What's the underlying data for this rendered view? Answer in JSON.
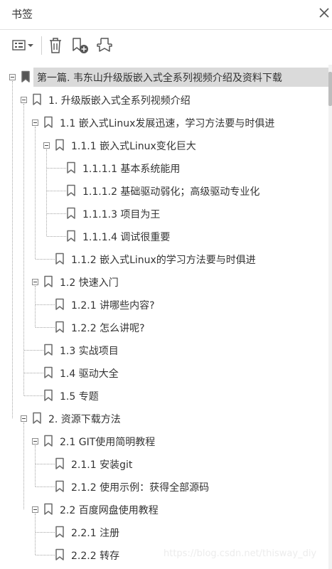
{
  "panel": {
    "title": "书签",
    "close_icon": "close-icon"
  },
  "toolbar": {
    "buttons": [
      {
        "icon": "options-menu-icon"
      },
      {
        "icon": "trash-icon"
      },
      {
        "icon": "add-bookmark-icon"
      },
      {
        "icon": "find-bookmark-icon"
      }
    ]
  },
  "tree": {
    "items": [
      {
        "label": "第一篇. 韦东山升级版嵌入式全系列视频介绍及资料下载",
        "level": 0,
        "expanded": true,
        "selected": true
      },
      {
        "label": "1. 升级版嵌入式全系列视频介绍",
        "level": 1,
        "expanded": true
      },
      {
        "label": "1.1 嵌入式Linux发展迅速，学习方法要与时俱进",
        "level": 2,
        "expanded": true
      },
      {
        "label": "1.1.1 嵌入式Linux变化巨大",
        "level": 3,
        "expanded": true
      },
      {
        "label": "1.1.1.1 基本系统能用",
        "level": 4
      },
      {
        "label": "1.1.1.2 基础驱动弱化；高级驱动专业化",
        "level": 4
      },
      {
        "label": "1.1.1.3 项目为王",
        "level": 4
      },
      {
        "label": "1.1.1.4 调试很重要",
        "level": 4
      },
      {
        "label": "1.1.2 嵌入式Linux的学习方法要与时俱进",
        "level": 3
      },
      {
        "label": "1.2 快速入门",
        "level": 2,
        "expanded": true
      },
      {
        "label": "1.2.1 讲哪些内容?",
        "level": 3
      },
      {
        "label": "1.2.2 怎么讲呢?",
        "level": 3
      },
      {
        "label": "1.3 实战项目",
        "level": 2
      },
      {
        "label": "1.4 驱动大全",
        "level": 2
      },
      {
        "label": "1.5 专题",
        "level": 2
      },
      {
        "label": "2. 资源下载方法",
        "level": 1,
        "expanded": true
      },
      {
        "label": "2.1 GIT使用简明教程",
        "level": 2,
        "expanded": true
      },
      {
        "label": "2.1.1 安装git",
        "level": 3
      },
      {
        "label": "2.1.2 使用示例：获得全部源码",
        "level": 3
      },
      {
        "label": "2.2 百度网盘使用教程",
        "level": 2,
        "expanded": true
      },
      {
        "label": "2.2.1 注册",
        "level": 3
      },
      {
        "label": "2.2.2 转存",
        "level": 3
      }
    ]
  },
  "watermark": "https://blog.csdn.net/thisway_diy",
  "colors": {
    "selected_bg": "#dadada",
    "icon_gray": "#6b6b6b",
    "text": "#333333"
  }
}
